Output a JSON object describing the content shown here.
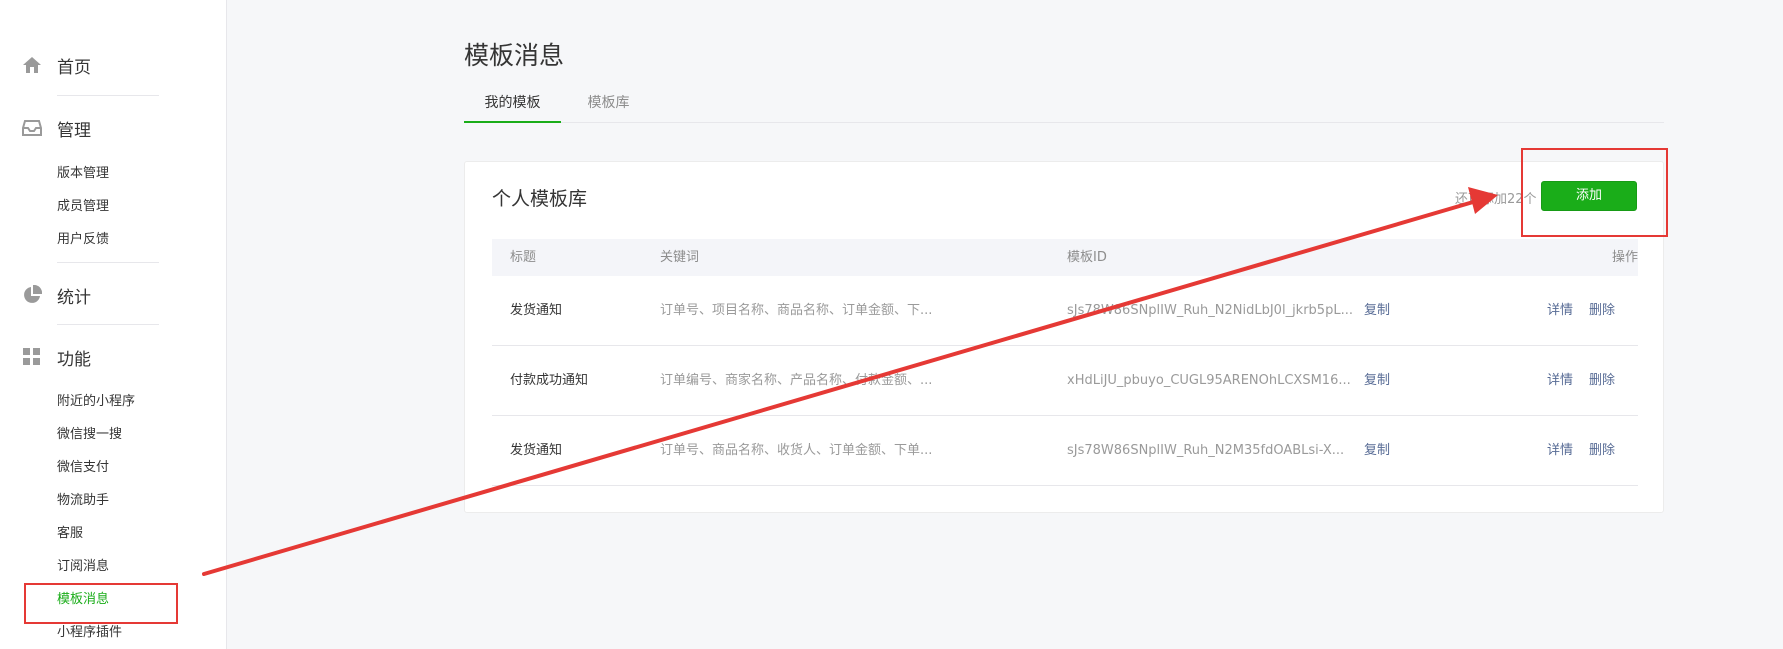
{
  "sidebar": {
    "home": {
      "label": "首页",
      "icon": "home-icon"
    },
    "manage": {
      "label": "管理",
      "icon": "inbox-icon",
      "items": [
        "版本管理",
        "成员管理",
        "用户反馈"
      ]
    },
    "stats": {
      "label": "统计",
      "icon": "pie-chart-icon"
    },
    "features": {
      "label": "功能",
      "icon": "grid-icon",
      "items": [
        "附近的小程序",
        "微信搜一搜",
        "微信支付",
        "物流助手",
        "客服",
        "订阅消息",
        "模板消息",
        "小程序插件"
      ],
      "active_item": "模板消息"
    }
  },
  "page": {
    "title": "模板消息",
    "tabs": [
      {
        "label": "我的模板",
        "active": true
      },
      {
        "label": "模板库",
        "active": false
      }
    ]
  },
  "card": {
    "title": "个人模板库",
    "remain_text": "还可添加22个",
    "add_button": "添加",
    "columns": [
      "标题",
      "关键词",
      "模板ID",
      "操作"
    ],
    "rows": [
      {
        "title": "发货通知",
        "keywords": "订单号、项目名称、商品名称、订单金额、下...",
        "template_id": "sJs78W86SNplIW_Ruh_N2NidLbJ0l_jkrb5pL...",
        "copy": "复制",
        "detail": "详情",
        "delete": "删除"
      },
      {
        "title": "付款成功通知",
        "keywords": "订单编号、商家名称、产品名称、付款金额、...",
        "template_id": "xHdLiJU_pbuyo_CUGL95ARENOhLCXSM16...",
        "copy": "复制",
        "detail": "详情",
        "delete": "删除"
      },
      {
        "title": "发货通知",
        "keywords": "订单号、商品名称、收货人、订单金额、下单...",
        "template_id": "sJs78W86SNplIW_Ruh_N2M35fdOABLsi-X...",
        "copy": "复制",
        "detail": "详情",
        "delete": "删除"
      }
    ]
  },
  "colors": {
    "accent": "#1aad19",
    "link": "#576b95",
    "annotation": "#e53935"
  }
}
